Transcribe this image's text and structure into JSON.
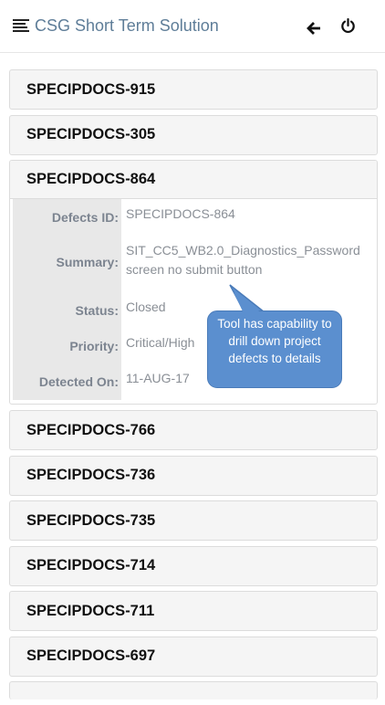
{
  "header": {
    "title": "CSG Short Term Solution",
    "menu_icon": "menu-icon",
    "back_icon": "arrow-left-icon",
    "power_icon": "power-icon"
  },
  "defects": [
    {
      "id": "SPECIPDOCS-915"
    },
    {
      "id": "SPECIPDOCS-305"
    },
    {
      "id": "SPECIPDOCS-864",
      "expanded": true
    },
    {
      "id": "SPECIPDOCS-766"
    },
    {
      "id": "SPECIPDOCS-736"
    },
    {
      "id": "SPECIPDOCS-735"
    },
    {
      "id": "SPECIPDOCS-714"
    },
    {
      "id": "SPECIPDOCS-711"
    },
    {
      "id": "SPECIPDOCS-697"
    }
  ],
  "details": {
    "defect_id_label": "Defects ID:",
    "defect_id_value": "SPECIPDOCS-864",
    "summary_label": "Summary:",
    "summary_value": "SIT_CC5_WB2.0_Diagnostics_Password screen no submit button",
    "status_label": "Status:",
    "status_value": "Closed",
    "priority_label": "Priority:",
    "priority_value": "Critical/High",
    "detected_label": "Detected On:",
    "detected_value": "11-AUG-17"
  },
  "callout": {
    "text": "Tool has capability to drill down project defects to details"
  },
  "colors": {
    "title": "#5e7d98",
    "callout": "#5b8fcf"
  }
}
